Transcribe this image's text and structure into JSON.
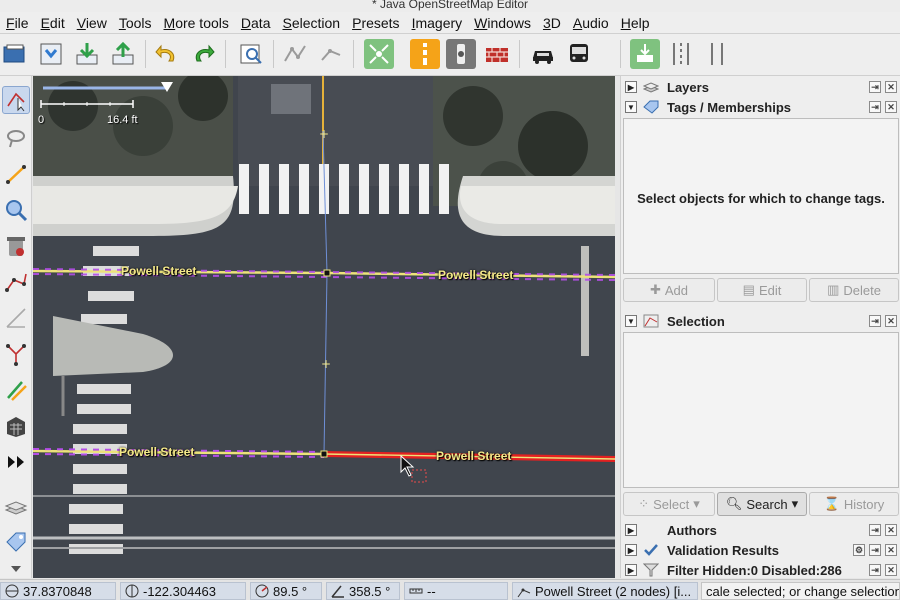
{
  "window": {
    "title": "* Java OpenStreetMap Editor"
  },
  "menu": [
    "File",
    "Edit",
    "View",
    "Tools",
    "More tools",
    "Data",
    "Selection",
    "Presets",
    "Imagery",
    "Windows",
    "3D",
    "Audio",
    "Help"
  ],
  "toolbar": {
    "icons": [
      "open-file-icon",
      "save-icon",
      "download-icon",
      "upload-icon",
      "undo-icon",
      "redo-icon",
      "preferences-icon",
      "wireframe-icon",
      "wireframe2-icon",
      "zoom-selection-icon",
      "traffic-light-icon",
      "railway-crossing-icon",
      "barrier-icon",
      "car-icon",
      "bus-icon",
      "download-layer-icon",
      "lanes-icon",
      "lanes2-icon"
    ],
    "colors": {
      "traffic": "#f5a318",
      "barrier": "#c0302a"
    }
  },
  "map": {
    "scale_start": "0",
    "scale_end": "16.4 ft",
    "street_labels": {
      "upper_left": "Powell Street",
      "upper_right": "Powell Street",
      "lower_left": "Powell Street",
      "lower_right": "Powell Street"
    },
    "colors": {
      "way": "#ece27a",
      "dash": "#b44ee8",
      "selected": "#e42020",
      "link": "#6e8fd6"
    }
  },
  "panels": {
    "layers": {
      "title": "Layers"
    },
    "tags": {
      "title": "Tags / Memberships",
      "message": "Select objects for which to change tags.",
      "add": "Add",
      "edit": "Edit",
      "delete": "Delete"
    },
    "selection": {
      "title": "Selection",
      "select": "Select",
      "search": "Search",
      "history": "History"
    },
    "authors": {
      "title": "Authors"
    },
    "validation": {
      "title": "Validation Results"
    },
    "filter": {
      "title": "Filter Hidden:0 Disabled:286"
    }
  },
  "status": {
    "lat": "37.8370848",
    "lon": "-122.304463",
    "heading": "89.5 °",
    "angle": "358.5 °",
    "distance": "--",
    "selection_info": "Powell Street (2 nodes) [i...",
    "help": "cale selected; or change selection"
  }
}
